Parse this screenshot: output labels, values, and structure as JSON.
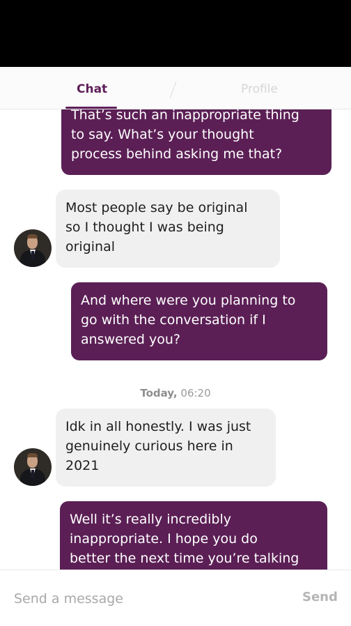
{
  "tabs": {
    "chat": "Chat",
    "profile": "Profile",
    "active": "chat"
  },
  "messages": [
    {
      "from": "me",
      "text": "That’s such an inappropriate thing\nto say. What’s your thought\nprocess behind asking me that?"
    },
    {
      "from": "them",
      "text": "Most people say be original\nso I thought I was being\noriginal"
    },
    {
      "from": "me",
      "text": "And where were you planning to\ngo with the conversation if I\nanswered you?"
    },
    {
      "from": "them",
      "text": "Idk in all honestly. I was just\ngenuinely curious here in\n2021"
    },
    {
      "from": "me",
      "text": "Well it’s really incredibly\ninappropriate. I hope you do\nbetter the next time you’re talking"
    }
  ],
  "timestamp": {
    "day": "Today,",
    "time": "06:20"
  },
  "composer": {
    "placeholder": "Send a message",
    "send_label": "Send"
  },
  "colors": {
    "accent": "#5e1f59",
    "sent_bubble": "#5b1f55",
    "received_bubble": "#f0f0f0"
  },
  "icons": {
    "avatar": "person-in-suit-avatar"
  }
}
